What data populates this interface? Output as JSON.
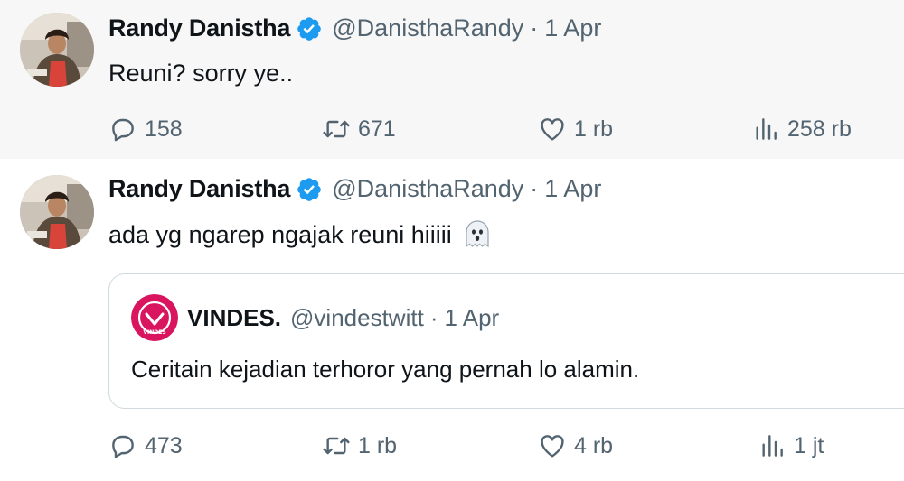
{
  "tweets": [
    {
      "author": {
        "name": "Randy Danistha",
        "handle": "@DanisthaRandy",
        "verified": true
      },
      "separator": "·",
      "date": "1 Apr",
      "text": "Reuni? sorry ye..",
      "stats": {
        "replies": "158",
        "retweets": "671",
        "likes": "1 rb",
        "views": "258 rb"
      }
    },
    {
      "author": {
        "name": "Randy Danistha",
        "handle": "@DanisthaRandy",
        "verified": true
      },
      "separator": "·",
      "date": "1 Apr",
      "text": "ada yg ngarep ngajak reuni hiiiii",
      "emoji": "ghost-emoji",
      "quote": {
        "author": {
          "name": "VINDES.",
          "handle": "@vindestwitt"
        },
        "separator": "·",
        "date": "1 Apr",
        "text": "Ceritain kejadian terhoror yang pernah lo alamin.",
        "avatar_label": "VINDES"
      },
      "stats": {
        "replies": "473",
        "retweets": "1 rb",
        "likes": "4 rb",
        "views": "1 jt"
      }
    }
  ],
  "colors": {
    "verified": "#1d9bf0",
    "muted_text": "#536471",
    "primary_text": "#0f1419",
    "highlight_bg": "#f7f7f7",
    "quote_border": "#cfd9de",
    "vindes_brand": "#d8155e"
  }
}
